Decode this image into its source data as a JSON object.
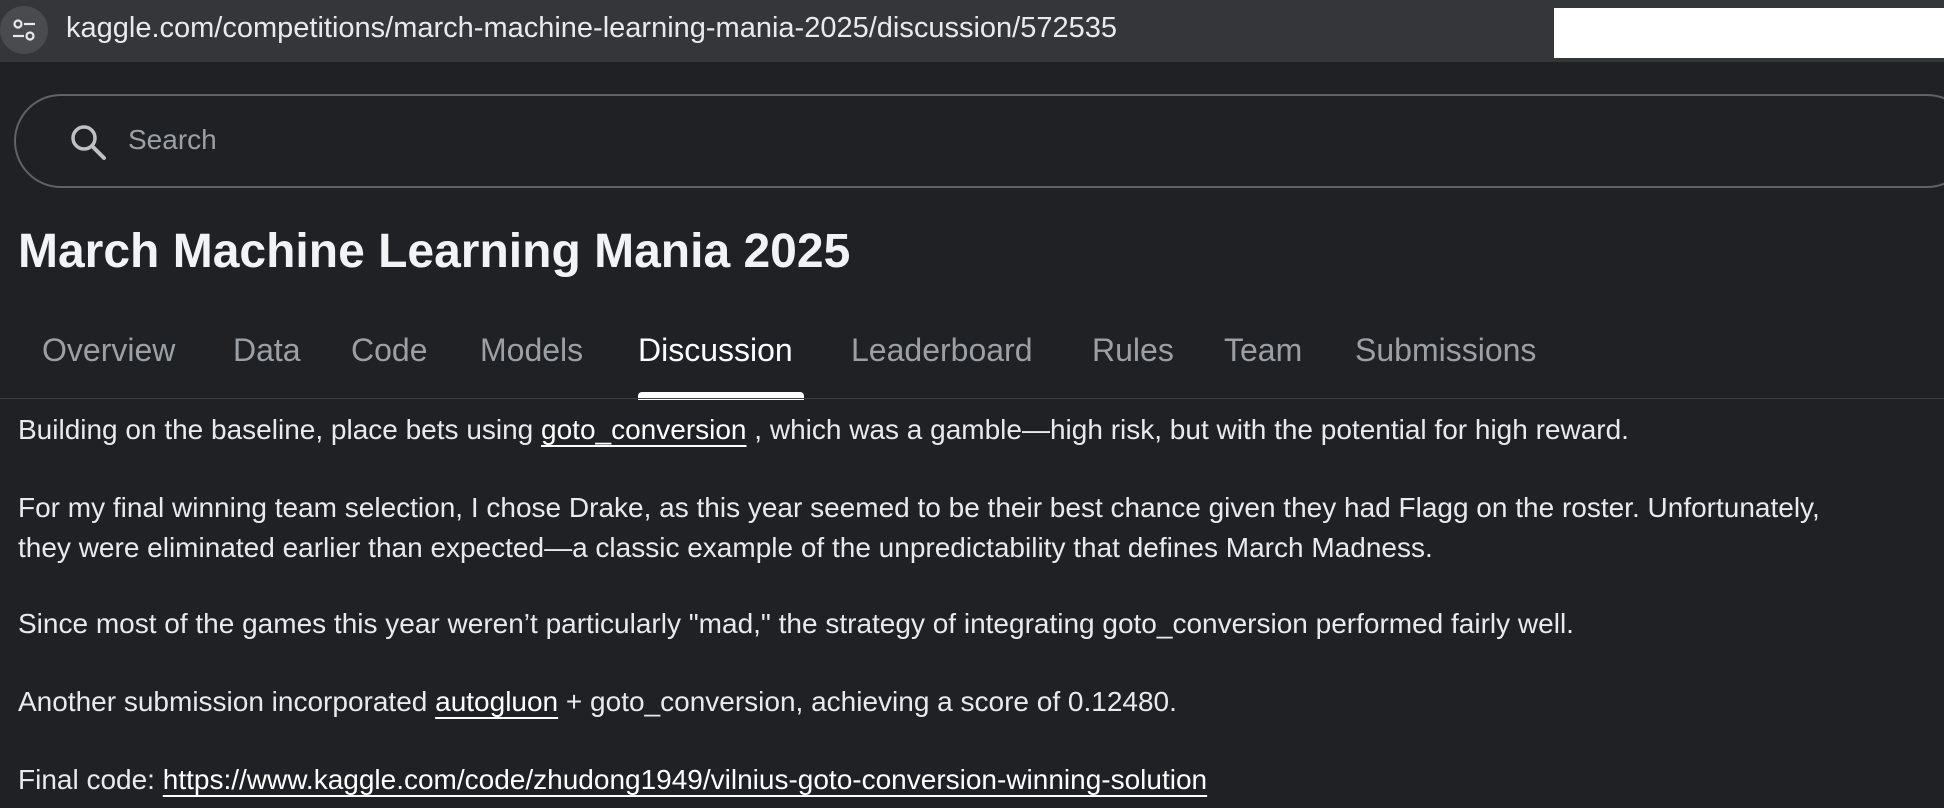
{
  "browser": {
    "url": "kaggle.com/competitions/march-machine-learning-mania-2025/discussion/572535",
    "site_info_icon": "tune-icon"
  },
  "search": {
    "placeholder": "Search"
  },
  "competition": {
    "title": "March Machine Learning Mania 2025"
  },
  "tabs": [
    {
      "label": "Overview"
    },
    {
      "label": "Data"
    },
    {
      "label": "Code"
    },
    {
      "label": "Models"
    },
    {
      "label": "Discussion",
      "active": true
    },
    {
      "label": "Leaderboard"
    },
    {
      "label": "Rules"
    },
    {
      "label": "Team"
    },
    {
      "label": "Submissions"
    }
  ],
  "post": {
    "p1": {
      "before": "Building on the baseline, place bets using ",
      "link": "goto_conversion",
      "after": " , which was a gamble—high risk, but with the potential for high reward."
    },
    "p2": {
      "line1": "For my final winning team selection, I chose Drake, as this year seemed to be their best chance given they had Flagg on the roster. Unfortunately,",
      "line2": "they were eliminated earlier than expected—a classic example of the unpredictability that defines March Madness."
    },
    "p3": "Since most of the games this year weren’t particularly \"mad,\" the strategy of integrating goto_conversion performed fairly well.",
    "p4": {
      "before": "Another submission incorporated ",
      "link": "autogluon",
      "after": " + goto_conversion, achieving a score of 0.12480."
    },
    "p5": {
      "label": "Final code: ",
      "link": "https://www.kaggle.com/code/zhudong1949/vilnius-goto-conversion-winning-solution"
    }
  },
  "colors": {
    "background": "#202124",
    "addressbar": "#35363a",
    "text": "#e8eaed",
    "muted": "#9aa0a6",
    "active_tab": "#ffffff"
  }
}
